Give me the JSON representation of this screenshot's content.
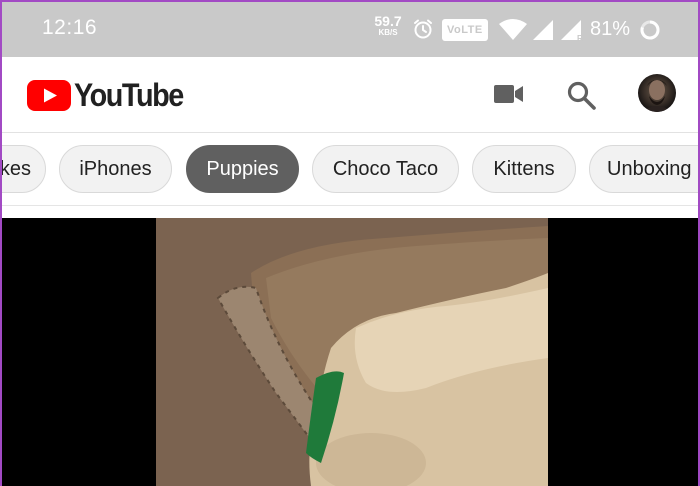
{
  "status_bar": {
    "time": "12:16",
    "net_speed_value": "59.7",
    "net_speed_unit": "KB/S",
    "volte_label": "VoLTE",
    "battery_percent": "81%",
    "icons": [
      "alarm-icon",
      "volte-icon",
      "wifi-icon",
      "signal-icon",
      "signal-icon",
      "battery-ring-icon"
    ],
    "background": "#c9c9c9"
  },
  "header": {
    "logo_text": "YouTube",
    "brand_red": "#ff0000",
    "icons": [
      "camera-icon",
      "search-icon",
      "avatar"
    ]
  },
  "chips": [
    {
      "label": "kes",
      "selected": false
    },
    {
      "label": "iPhones",
      "selected": false
    },
    {
      "label": "Puppies",
      "selected": true
    },
    {
      "label": "Choco Taco",
      "selected": false
    },
    {
      "label": "Kittens",
      "selected": false
    },
    {
      "label": "Unboxing",
      "selected": false
    }
  ],
  "video": {
    "content": "video frame"
  }
}
